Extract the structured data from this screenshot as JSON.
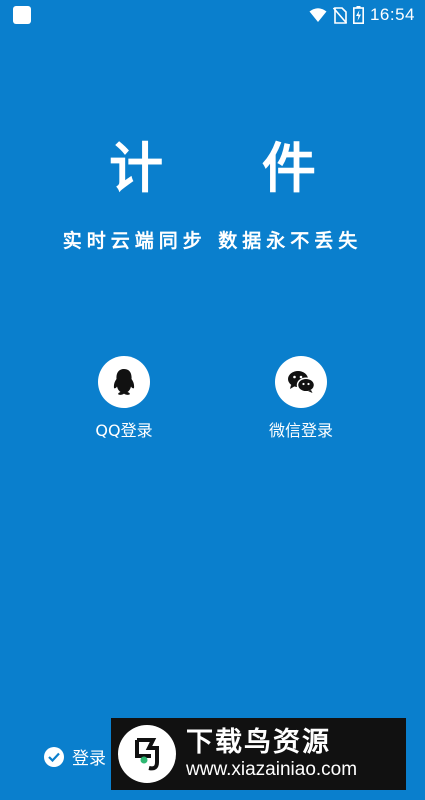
{
  "status_bar": {
    "time": "16:54",
    "icons": [
      "app-notification-icon",
      "wifi-icon",
      "no-sim-icon",
      "battery-charging-icon"
    ]
  },
  "app": {
    "title": "计 件",
    "tagline": "实时云端同步  数据永不丢失"
  },
  "login": {
    "qq_label": "QQ登录",
    "wechat_label": "微信登录",
    "icons": [
      "qq-penguin-icon",
      "wechat-icon"
    ]
  },
  "agreement": {
    "text": "登录",
    "checked": true
  },
  "watermark": {
    "title": "下载鸟资源",
    "url": "www.xiazainiao.com"
  },
  "colors": {
    "background": "#0a7fcd",
    "foreground": "#ffffff",
    "watermark_bg": "#111111"
  }
}
